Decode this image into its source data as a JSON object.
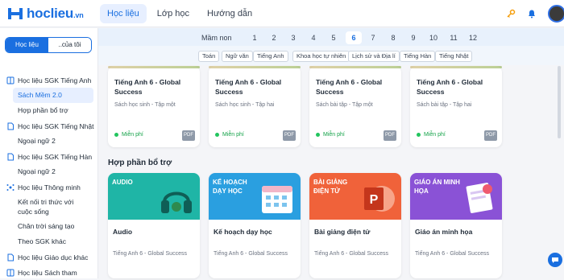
{
  "header": {
    "logo_text": "hoclieu",
    "logo_suffix": ".vn",
    "tabs": [
      {
        "label": "Học liệu",
        "active": true
      },
      {
        "label": "Lớp học",
        "active": false
      },
      {
        "label": "Hướng dẫn",
        "active": false
      }
    ]
  },
  "sidebar": {
    "toggle": {
      "left": "Học liệu",
      "right": "..của tôi"
    },
    "items": [
      {
        "type": "group",
        "label": "Học liệu SGK Tiếng Anh",
        "icon": "book-icon"
      },
      {
        "type": "sub",
        "label": "Sách Mềm 2.0",
        "active": true
      },
      {
        "type": "sub",
        "label": "Hợp phần bổ trợ"
      },
      {
        "type": "group",
        "label": "Học liệu SGK Tiếng Nhật",
        "icon": "document-icon"
      },
      {
        "type": "sub",
        "label": "Ngoại ngữ 2"
      },
      {
        "type": "group",
        "label": "Học liệu SGK Tiếng Hàn",
        "icon": "document-icon"
      },
      {
        "type": "sub",
        "label": "Ngoại ngữ 2"
      },
      {
        "type": "group",
        "label": "Học liệu Thông minh",
        "icon": "network-icon"
      },
      {
        "type": "sub2",
        "label": "Kết nối tri thức với cuộc sống"
      },
      {
        "type": "sub",
        "label": "Chân trời sáng tạo"
      },
      {
        "type": "sub",
        "label": "Theo SGK khác"
      },
      {
        "type": "group",
        "label": "Học liệu Giáo dục khác",
        "icon": "document-icon"
      },
      {
        "type": "group",
        "label": "Học liệu Sách tham",
        "icon": "book-icon"
      }
    ]
  },
  "grades": {
    "label": "Mầm non",
    "items": [
      "1",
      "2",
      "3",
      "4",
      "5",
      "6",
      "7",
      "8",
      "9",
      "10",
      "11",
      "12"
    ],
    "active": "6"
  },
  "subjects": [
    "Toán",
    "Ngữ văn",
    "Tiếng Anh",
    "Khoa học tự nhiên",
    "Lịch sử và Địa lí",
    "Tiếng Hàn",
    "Tiếng Nhật"
  ],
  "books": [
    {
      "title": "Tiếng Anh 6 - Global Success",
      "meta": "Sách học sinh - Tập một",
      "badge": "Miễn phí",
      "format": "PDF"
    },
    {
      "title": "Tiếng Anh 6 - Global Success",
      "meta": "Sách học sinh - Tập hai",
      "badge": "Miễn phí",
      "format": "PDF"
    },
    {
      "title": "Tiếng Anh 6 - Global Success",
      "meta": "Sách bài tập - Tập một",
      "badge": "Miễn phí",
      "format": "PDF"
    },
    {
      "title": "Tiếng Anh 6 - Global Success",
      "meta": "Sách bài tập - Tập hai",
      "badge": "Miễn phí",
      "format": "PDF"
    }
  ],
  "section_title": "Hợp phần bổ trợ",
  "supplements": [
    {
      "banner": "AUDIO",
      "name": "Audio",
      "sub": "Tiếng Anh 6 - Global Success",
      "color": "#1fb5a6"
    },
    {
      "banner": "KẾ HOẠCH DẠY HỌC",
      "name": "Kế hoạch dạy học",
      "sub": "Tiếng Anh 6 - Global Success",
      "color": "#2a9fe0"
    },
    {
      "banner": "BÀI GIẢNG ĐIỆN TỬ",
      "name": "Bài giảng điện tử",
      "sub": "Tiếng Anh 6 - Global Success",
      "color": "#f0623a"
    },
    {
      "banner": "GIÁO ÁN MINH HỌA",
      "name": "Giáo án minh họa",
      "sub": "Tiếng Anh 6 - Global Success",
      "color": "#8a52d6"
    }
  ]
}
